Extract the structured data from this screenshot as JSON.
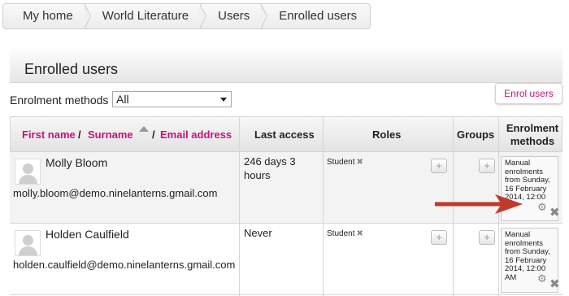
{
  "breadcrumb": [
    "My home",
    "World Literature",
    "Users",
    "Enrolled users"
  ],
  "page_title": "Enrolled users",
  "filter": {
    "label": "Enrolment methods",
    "value": "All"
  },
  "enrol_button": "Enrol users",
  "columns": {
    "first_name": "First name",
    "sep1": " / ",
    "surname": "Surname",
    "sep2": " / ",
    "email": "Email address",
    "last_access": "Last access",
    "roles": "Roles",
    "groups": "Groups",
    "enrolment_methods_line1": "Enrolment",
    "enrolment_methods_line2": "methods"
  },
  "users": [
    {
      "name": "Molly Bloom",
      "email": "molly.bloom@demo.ninelanterns.gmail.com",
      "last_access": "246 days 3 hours",
      "role": "Student",
      "method_lines": [
        "Manual",
        "enrolments",
        "from Sunday,",
        "16 February",
        "2014, 12:00"
      ]
    },
    {
      "name": "Holden Caulfield",
      "email": "holden.caulfield@demo.ninelanterns.gmail.com",
      "last_access": "Never",
      "role": "Student",
      "method_lines": [
        "Manual",
        "enrolments",
        "from Sunday,",
        "16 February",
        "2014, 12:00",
        "AM"
      ]
    }
  ],
  "icons": {
    "remove": "✖",
    "add": "+",
    "gear": "⚙"
  },
  "colors": {
    "link": "#c0157c",
    "arrow": "#c0392b"
  }
}
